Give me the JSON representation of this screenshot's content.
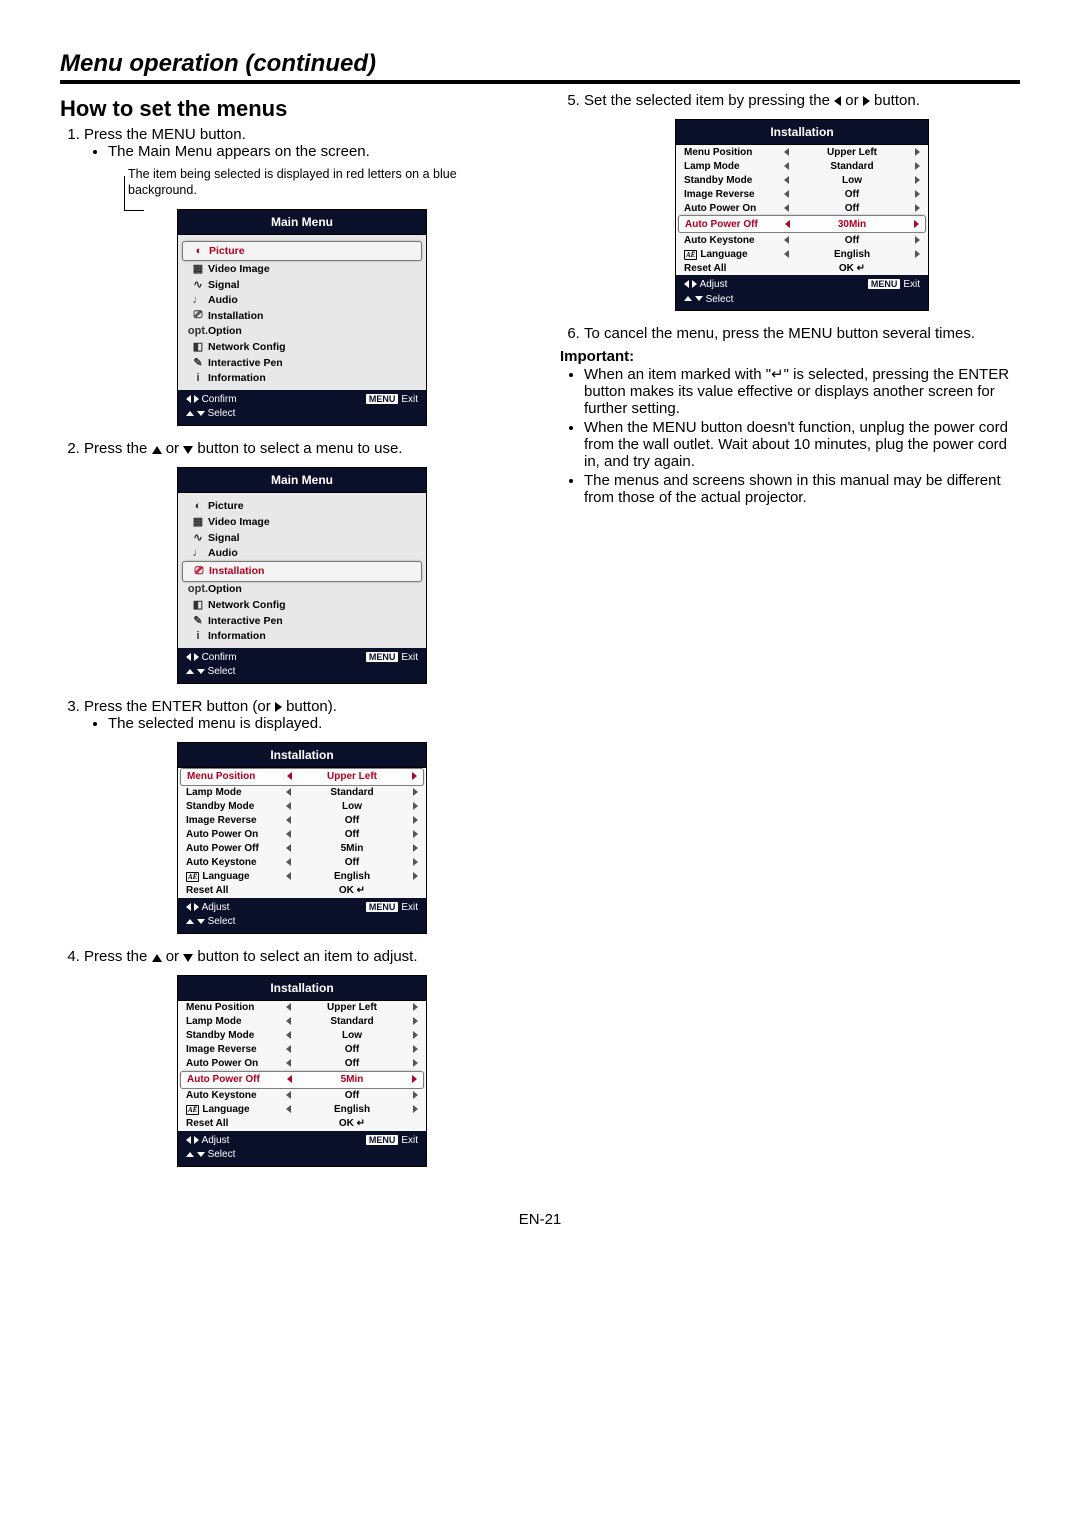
{
  "title_bar": "Menu operation (continued)",
  "heading": "How to set the menus",
  "page_num": "EN-21",
  "steps": {
    "s1": "Press the MENU button.",
    "s1b": "The Main Menu appears on the screen.",
    "s1hint": "The item being selected is displayed in red letters on a blue background.",
    "s2a": "Press the ",
    "s2b": " or ",
    "s2c": " button to select a menu to use.",
    "s3a": "Press the ENTER button (or ",
    "s3b": " button).",
    "s3c": "The selected menu is displayed.",
    "s4a": "Press the ",
    "s4b": " or ",
    "s4c": " button to select an item to adjust.",
    "s5a": "Set the selected item by pressing the ",
    "s5b": " or ",
    "s5c": " button.",
    "s6": "To cancel the menu, press the MENU button several times."
  },
  "important_label": "Important:",
  "important": {
    "i1": "When an item marked with \"↵\" is selected, pressing the ENTER button makes its value effective or displays another screen for further setting.",
    "i2": "When the MENU button doesn't function, unplug the power cord from the wall outlet. Wait about 10 minutes, plug the power cord in, and try again.",
    "i3": "The menus and screens shown in this manual may be different from those of the actual projector."
  },
  "main_menu": {
    "title": "Main Menu",
    "items": [
      "Picture",
      "Video Image",
      "Signal",
      "Audio",
      "Installation",
      "Option",
      "Network Config",
      "Interactive Pen",
      "Information"
    ],
    "icons": [
      "◐",
      "▦",
      "∿",
      "♩",
      "⎚",
      "opt.",
      "◧",
      "✎",
      "i"
    ],
    "hint1a": "Confirm",
    "hint1b": "Exit",
    "hint2": "Select",
    "menu_label": "MENU"
  },
  "installation": {
    "title": "Installation",
    "rows": [
      {
        "label": "Menu Position",
        "value": "Upper Left"
      },
      {
        "label": "Lamp Mode",
        "value": "Standard"
      },
      {
        "label": "Standby Mode",
        "value": "Low"
      },
      {
        "label": "Image Reverse",
        "value": "Off"
      },
      {
        "label": "Auto Power On",
        "value": "Off"
      },
      {
        "label": "Auto Power Off",
        "value": "5Min"
      },
      {
        "label": "Auto Keystone",
        "value": "Off"
      },
      {
        "label": "Language",
        "value": "English",
        "lang": true
      },
      {
        "label": "Reset All",
        "value": "OK ↵",
        "noarr": true
      }
    ],
    "rows_step5": [
      {
        "label": "Menu Position",
        "value": "Upper Left"
      },
      {
        "label": "Lamp Mode",
        "value": "Standard"
      },
      {
        "label": "Standby Mode",
        "value": "Low"
      },
      {
        "label": "Image Reverse",
        "value": "Off"
      },
      {
        "label": "Auto Power On",
        "value": "Off"
      },
      {
        "label": "Auto Power Off",
        "value": "30Min"
      },
      {
        "label": "Auto Keystone",
        "value": "Off"
      },
      {
        "label": "Language",
        "value": "English",
        "lang": true
      },
      {
        "label": "Reset All",
        "value": "OK ↵",
        "noarr": true
      }
    ],
    "hint1": "Adjust",
    "hint1b": "Exit",
    "hint2": "Select",
    "menu_label": "MENU"
  }
}
